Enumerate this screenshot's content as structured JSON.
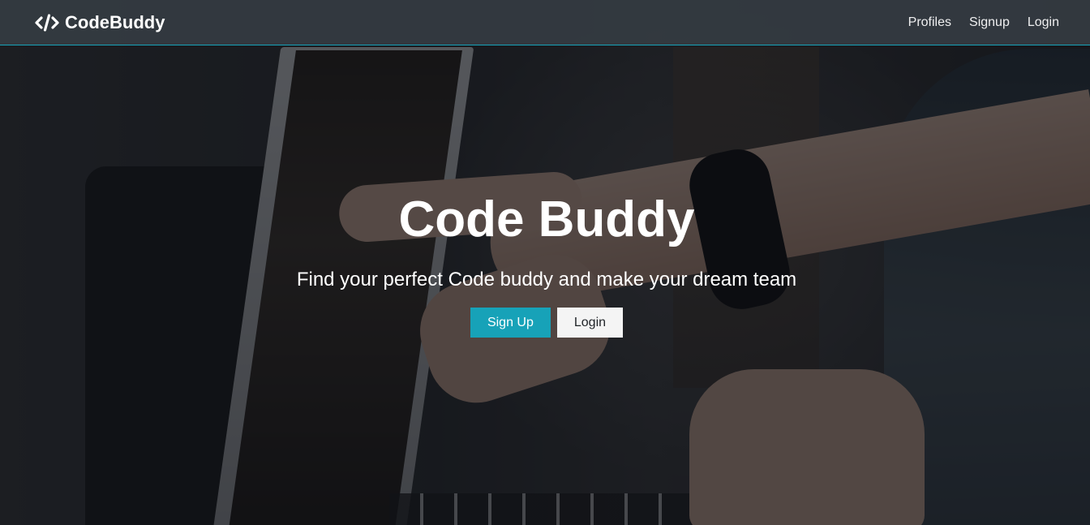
{
  "navbar": {
    "brand": {
      "icon": "code-icon",
      "label": "CodeBuddy"
    },
    "links": [
      {
        "label": "Profiles"
      },
      {
        "label": "Signup"
      },
      {
        "label": "Login"
      }
    ]
  },
  "hero": {
    "title": "Code Buddy",
    "subtitle": "Find your perfect Code buddy and make your dream team",
    "buttons": {
      "signup_label": "Sign Up",
      "login_label": "Login"
    }
  },
  "colors": {
    "accent": "#17a2b8",
    "navbar_bg": "#343a40",
    "light_button": "#f4f4f4"
  }
}
